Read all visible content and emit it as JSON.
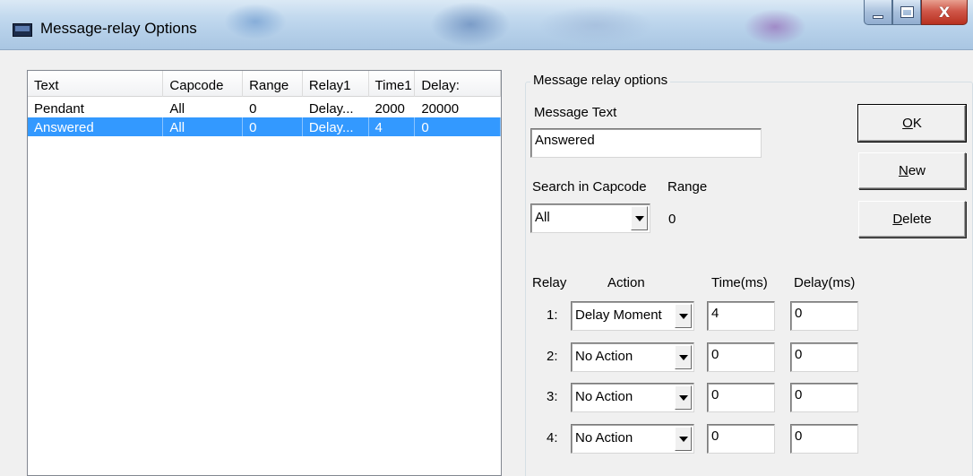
{
  "window": {
    "title": "Message-relay Options"
  },
  "list": {
    "columns": [
      "Text",
      "Capcode",
      "Range",
      "Relay1",
      "Time1",
      "Delay:"
    ],
    "rows": [
      {
        "text": "Pendant",
        "capcode": "All",
        "range": "0",
        "relay1": "Delay...",
        "time1": "2000",
        "delay": "20000",
        "selected": false
      },
      {
        "text": "Answered",
        "capcode": "All",
        "range": "0",
        "relay1": "Delay...",
        "time1": "4",
        "delay": "0",
        "selected": true
      }
    ]
  },
  "options": {
    "group_label": "Message relay options",
    "message_text_label": "Message Text",
    "message_text_value": "Answered",
    "search_capcode_label": "Search in Capcode",
    "range_label": "Range",
    "capcode_value": "All",
    "range_value": "0",
    "relay_header": "Relay",
    "action_header": "Action",
    "time_header": "Time(ms)",
    "delay_header": "Delay(ms)",
    "relays": [
      {
        "num": "1:",
        "action": "Delay Moment",
        "time": "4",
        "delay": "0"
      },
      {
        "num": "2:",
        "action": "No Action",
        "time": "0",
        "delay": "0"
      },
      {
        "num": "3:",
        "action": "No Action",
        "time": "0",
        "delay": "0"
      },
      {
        "num": "4:",
        "action": "No Action",
        "time": "0",
        "delay": "0"
      }
    ]
  },
  "buttons": {
    "ok_mnemonic": "O",
    "ok_rest": "K",
    "new_mnemonic": "N",
    "new_rest": "ew",
    "delete_mnemonic": "D",
    "delete_rest": "elete"
  },
  "icons": {
    "app": "console-window-icon",
    "minimize": "minimize-icon",
    "maximize": "maximize-icon",
    "close": "close-icon"
  }
}
